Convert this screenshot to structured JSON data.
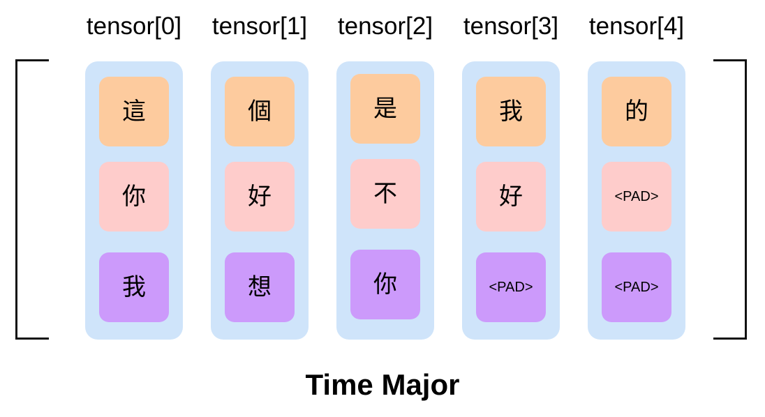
{
  "caption": "Time Major",
  "colors": {
    "column_bg": "#cfe4fa",
    "row_colors": [
      "#fdcb9e",
      "#fecccb",
      "#cc9afb"
    ],
    "bracket": "#111111"
  },
  "columns": [
    {
      "label": "tensor[0]",
      "cells": [
        "這",
        "你",
        "我"
      ]
    },
    {
      "label": "tensor[1]",
      "cells": [
        "個",
        "好",
        "想"
      ]
    },
    {
      "label": "tensor[2]",
      "cells": [
        "是",
        "不",
        "你"
      ]
    },
    {
      "label": "tensor[3]",
      "cells": [
        "我",
        "好",
        "<PAD>"
      ]
    },
    {
      "label": "tensor[4]",
      "cells": [
        "的",
        "<PAD>",
        "<PAD>"
      ]
    }
  ]
}
